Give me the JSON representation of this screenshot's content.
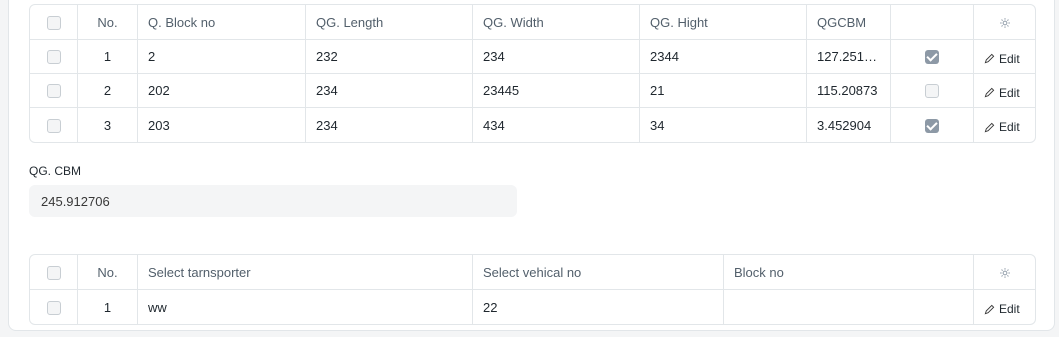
{
  "table1": {
    "headers": [
      "No.",
      "Q. Block no",
      "QG. Length",
      "QG. Width",
      "QG. Hight",
      "QGCBM"
    ],
    "rows": [
      {
        "no": "1",
        "block": "2",
        "length": "232",
        "width": "234",
        "hight": "2344",
        "cbm": "127.2510…",
        "checked": true,
        "edit": "Edit"
      },
      {
        "no": "2",
        "block": "202",
        "length": "234",
        "width": "23445",
        "hight": "21",
        "cbm": "115.20873",
        "checked": false,
        "edit": "Edit"
      },
      {
        "no": "3",
        "block": "203",
        "length": "234",
        "width": "434",
        "hight": "34",
        "cbm": "3.452904",
        "checked": true,
        "edit": "Edit"
      }
    ]
  },
  "qg_cbm": {
    "label": "QG. CBM",
    "value": "245.912706"
  },
  "table2": {
    "headers": [
      "No.",
      "Select tarnsporter",
      "Select vehical no",
      "Block no"
    ],
    "rows": [
      {
        "no": "1",
        "transporter": "ww",
        "vehicle": "22",
        "block": "",
        "edit": "Edit"
      }
    ]
  }
}
